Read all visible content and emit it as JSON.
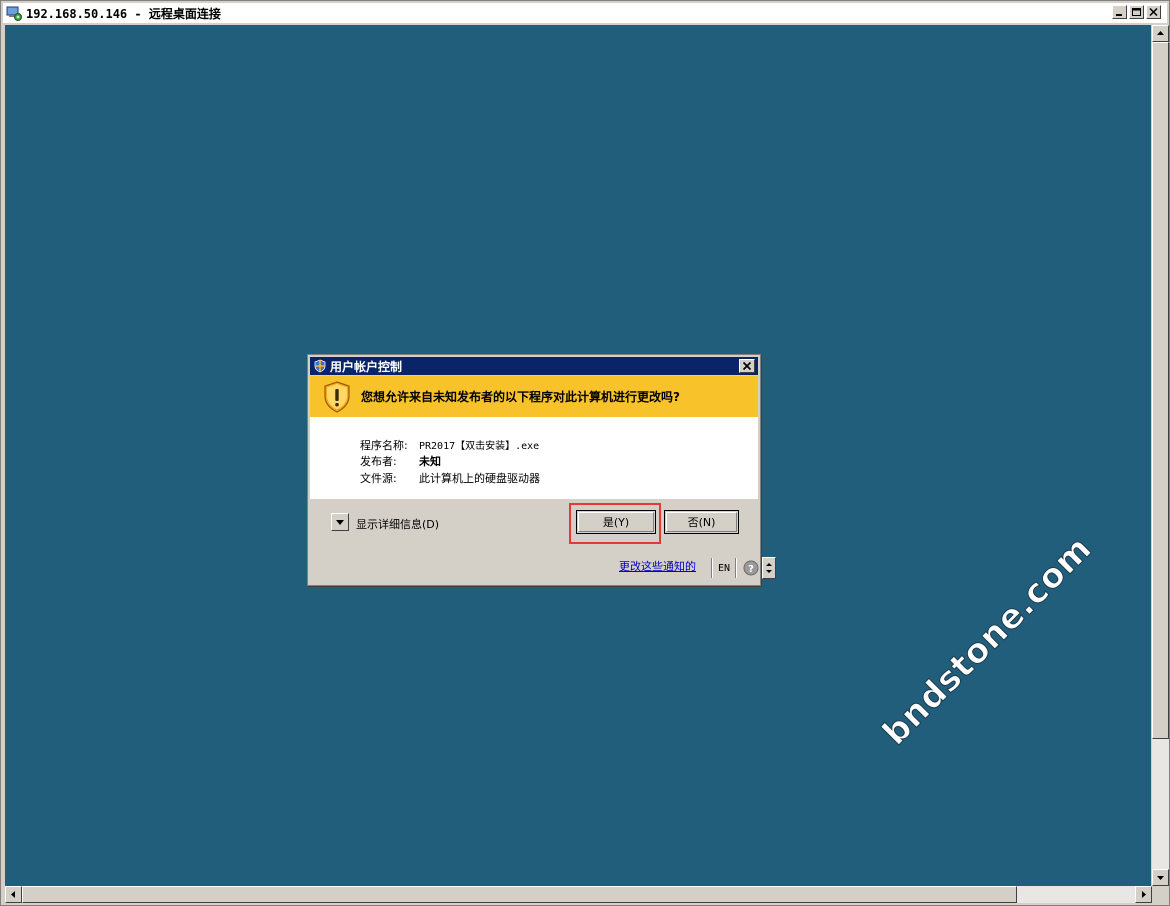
{
  "window": {
    "title": "192.168.50.146 - 远程桌面连接",
    "icon": "rdp-icon",
    "buttons": [
      "minimize",
      "maximize",
      "close"
    ]
  },
  "uac_dialog": {
    "title": "用户帐户控制",
    "question": "您想允许来自未知发布者的以下程序对此计算机进行更改吗?",
    "fields": [
      {
        "label": "程序名称:",
        "value": "PR2017【双击安装】.exe"
      },
      {
        "label": "发布者:",
        "value": "未知"
      },
      {
        "label": "文件源:",
        "value": "此计算机上的硬盘驱动器"
      }
    ],
    "details_toggle": "显示详细信息(D)",
    "yes_button": "是(Y)",
    "no_button": "否(N)",
    "change_link": "更改这些通知的",
    "language": "EN",
    "colors": {
      "banner": "#f8c22b",
      "titlebar": "#0a246a",
      "highlight": "#e53935"
    }
  },
  "desktop": {
    "background": "#215e7b"
  },
  "watermark": "bndstone.com"
}
